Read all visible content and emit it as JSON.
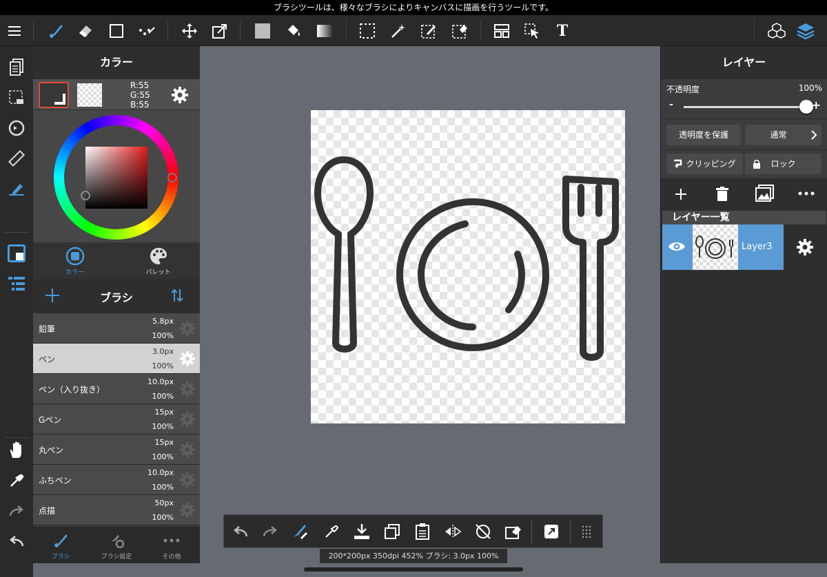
{
  "tooltip": "ブラシツールは、様々なブラシによりキャンバスに描画を行うツールです。",
  "toolbar": {
    "icons": [
      "menu-icon",
      "brush-icon",
      "eraser-icon",
      "rectangle-icon",
      "line-dots-icon",
      "move-icon",
      "transform-icon",
      "fill-rect-icon",
      "bucket-icon",
      "gradient-icon",
      "select-rect-icon",
      "magic-wand-icon",
      "select-pen-icon",
      "select-eraser-icon",
      "frame-icon",
      "select-arrow-icon",
      "text-icon",
      "materials-icon",
      "layers-icon"
    ],
    "text_tool_label": "T"
  },
  "color_panel": {
    "title": "カラー",
    "rgb": {
      "r": "R:55",
      "g": "G:55",
      "b": "B:55"
    },
    "tabs": [
      {
        "label": "カラー"
      },
      {
        "label": "パレット"
      }
    ],
    "foreground": "#373737",
    "accent": "#4a9ad9"
  },
  "brush_panel": {
    "title": "ブラシ",
    "brushes": [
      {
        "name": "鉛筆",
        "size": "5.8px",
        "opacity": "100%"
      },
      {
        "name": "ペン",
        "size": "3.0px",
        "opacity": "100%"
      },
      {
        "name": "ペン（入り抜き）",
        "size": "10.0px",
        "opacity": "100%"
      },
      {
        "name": "Gペン",
        "size": "15px",
        "opacity": "100%"
      },
      {
        "name": "丸ペン",
        "size": "15px",
        "opacity": "100%"
      },
      {
        "name": "ふちペン",
        "size": "10.0px",
        "opacity": "100%"
      },
      {
        "name": "点描",
        "size": "50px",
        "opacity": "100%"
      }
    ],
    "selected_index": 1
  },
  "bottom_tabs": [
    {
      "label": "ブラシ"
    },
    {
      "label": "ブラシ設定"
    },
    {
      "label": "その他"
    }
  ],
  "status": "200*200px 350dpi 452% ブラシ: 3.0px 100%",
  "layer_panel": {
    "title": "レイヤー",
    "opacity_label": "不透明度",
    "opacity_value": "100%",
    "opacity_fraction": 1.0,
    "minus": "-",
    "plus": "+",
    "protect_alpha": "透明度を保護",
    "blend_mode": "通常",
    "clipping": "クリッピング",
    "lock": "ロック",
    "list_title": "レイヤー一覧",
    "layers": [
      {
        "name": "Layer3"
      }
    ]
  }
}
